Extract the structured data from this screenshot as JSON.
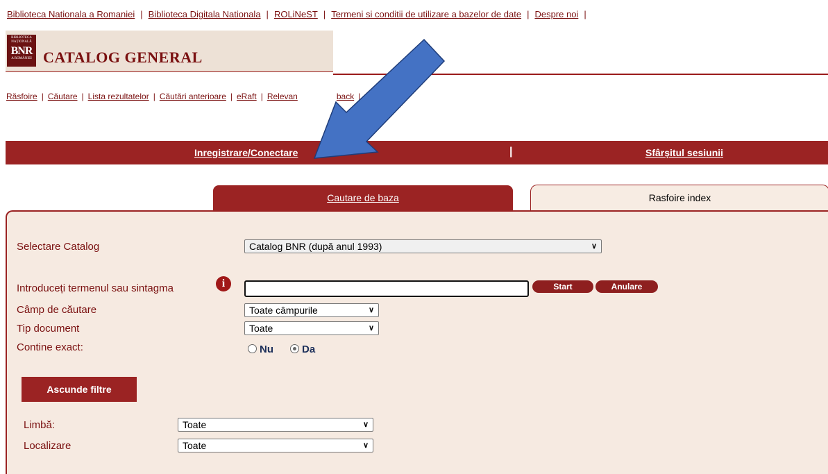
{
  "top_links": [
    "Biblioteca Nationala a Romaniei",
    "Biblioteca Digitala Nationala",
    "ROLiNeST",
    "Termeni si conditii de utilizare a bazelor de date",
    "Despre noi"
  ],
  "header": {
    "title": "CATALOG GENERAL",
    "logo_small": "BIBLIOTECA NAȚIONALĂ",
    "logo_big": "BNR",
    "logo_bottom": "A ROMÂNIEI"
  },
  "menu": [
    "Răsfoire",
    "Căutare",
    "Lista rezultatelor",
    "Căutări anterioare",
    "eRaft",
    "Relevan",
    "back"
  ],
  "bar": {
    "login": "Inregistrare/Conectare",
    "separator": "|",
    "logout": "Sfârșitul sesiunii"
  },
  "tabs": {
    "basic": "Cautare de baza",
    "browse": "Rasfoire index"
  },
  "form": {
    "catalog_label": "Selectare Catalog",
    "catalog_value": "Catalog BNR (după anul 1993)",
    "term_label": "Introduceți termenul sau sintagma",
    "info_glyph": "i",
    "term_value": "",
    "start_button": "Start",
    "cancel_button": "Anulare",
    "field_label": "Câmp de căutare",
    "field_value": "Toate câmpurile",
    "doctype_label": "Tip document",
    "doctype_value": "Toate",
    "exact_label": "Contine exact:",
    "exact_no": "Nu",
    "exact_yes": "Da",
    "exact_selected": "Da",
    "hide_filters": "Ascunde filtre",
    "lang_label": "Limbă:",
    "lang_value": "Toate",
    "location_label": "Localizare",
    "location_value": "Toate"
  },
  "colors": {
    "accent": "#9b2323",
    "link": "#7a1010",
    "panel_bg": "#f6eae1",
    "arrow": "#4472c4"
  }
}
